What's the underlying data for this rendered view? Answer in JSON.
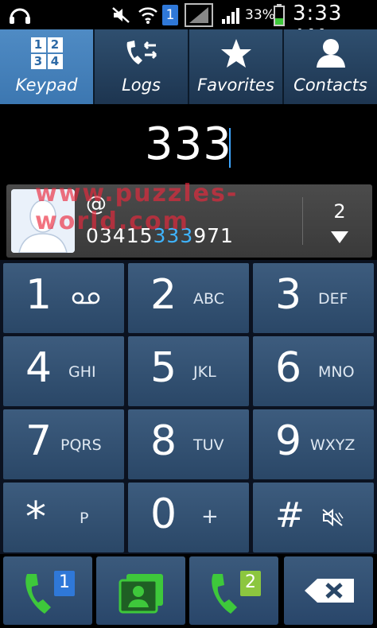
{
  "status_bar": {
    "battery_text": "33%",
    "time": "3:33 AM",
    "sim_badge": "1",
    "icons": [
      "headset-icon",
      "mute-icon",
      "wifi-icon",
      "sim-icon",
      "no-signal-icon",
      "signal-icon",
      "battery-icon"
    ]
  },
  "tabs": [
    {
      "label": "Keypad",
      "icon": "keypad-icon",
      "active": true
    },
    {
      "label": "Logs",
      "icon": "logs-icon",
      "active": false
    },
    {
      "label": "Favorites",
      "icon": "star-icon",
      "active": false
    },
    {
      "label": "Contacts",
      "icon": "contact-icon",
      "active": false
    }
  ],
  "keypad_tab_icon_digits": [
    "1",
    "2",
    "3",
    "4"
  ],
  "dialed_number": "333",
  "suggestion": {
    "name": "@",
    "phone_prefix": "03415",
    "phone_match": "333",
    "phone_suffix": "971",
    "count": "2"
  },
  "watermark": "www.puzzles-world.com",
  "keys": [
    {
      "digit": "1",
      "letters": "",
      "icon": "voicemail-icon"
    },
    {
      "digit": "2",
      "letters": "ABC"
    },
    {
      "digit": "3",
      "letters": "DEF"
    },
    {
      "digit": "4",
      "letters": "GHI"
    },
    {
      "digit": "5",
      "letters": "JKL"
    },
    {
      "digit": "6",
      "letters": "MNO"
    },
    {
      "digit": "7",
      "letters": "PQRS"
    },
    {
      "digit": "8",
      "letters": "TUV"
    },
    {
      "digit": "9",
      "letters": "WXYZ"
    },
    {
      "digit": "*",
      "letters": "P"
    },
    {
      "digit": "0",
      "letters": "+"
    },
    {
      "digit": "#",
      "letters": "",
      "icon": "silent-mode-icon"
    }
  ],
  "bottom_buttons": [
    {
      "name": "call-sim1-button",
      "icon": "phone-icon",
      "badge": "1"
    },
    {
      "name": "add-contact-button",
      "icon": "contact-card-icon"
    },
    {
      "name": "call-sim2-button",
      "icon": "phone-icon",
      "badge": "2"
    },
    {
      "name": "delete-button",
      "icon": "backspace-icon"
    }
  ],
  "colors": {
    "accent_blue": "#3fb4ff",
    "call_green": "#3ec83b",
    "tab_active": "#4a86c0",
    "key_bg": "#34536f"
  }
}
